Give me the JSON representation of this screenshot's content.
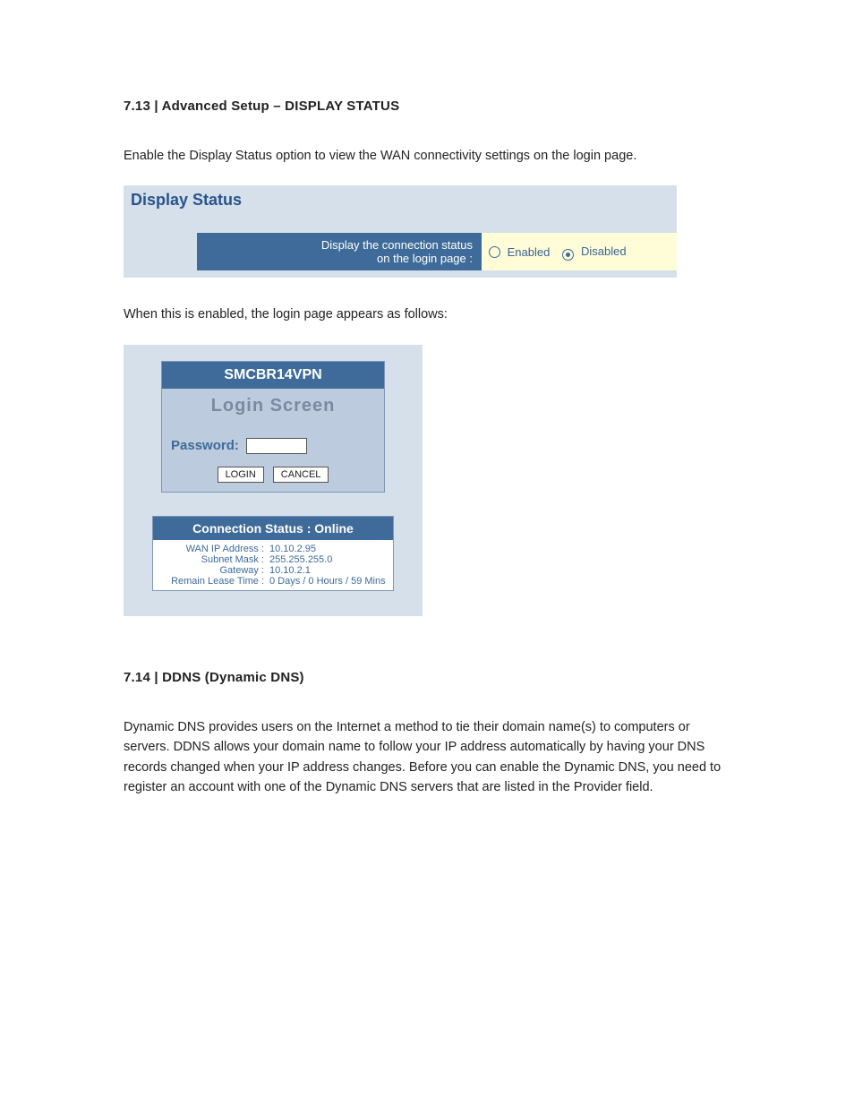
{
  "section713": {
    "heading": "7.13 | Advanced Setup – DISPLAY STATUS",
    "intro": "Enable the Display Status option to view the WAN connectivity settings on the login page.",
    "panel": {
      "title": "Display Status",
      "label_line1": "Display the connection status",
      "label_line2": "on the login page :",
      "option_enabled": "Enabled",
      "option_disabled": "Disabled",
      "selected": "disabled"
    },
    "followup": "When this is enabled, the login page appears as follows:"
  },
  "login_screenshot": {
    "header": "SMCBR14VPN",
    "sub": "Login  Screen",
    "password_label": "Password:",
    "login_btn": "LOGIN",
    "cancel_btn": "CANCEL",
    "status_header": "Connection Status : Online",
    "rows": [
      {
        "key": "WAN IP Address :",
        "val": "10.10.2.95"
      },
      {
        "key": "Subnet Mask :",
        "val": "255.255.255.0"
      },
      {
        "key": "Gateway :",
        "val": "10.10.2.1"
      },
      {
        "key": "Remain Lease Time :",
        "val": "0 Days / 0 Hours / 59 Mins"
      }
    ]
  },
  "section714": {
    "heading": "7.14 | DDNS (Dynamic DNS)",
    "body": "Dynamic DNS provides users on the Internet a method to tie their domain name(s) to computers or servers. DDNS allows your domain name to follow your IP address automatically by having your DNS records changed when your IP address changes. Before you can enable the Dynamic DNS, you need to register an account with one of the Dynamic DNS servers that are listed in the Provider field."
  }
}
